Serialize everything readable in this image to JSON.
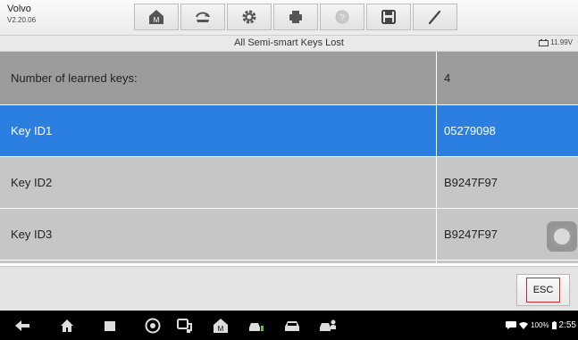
{
  "header": {
    "vehicle_make": "Volvo",
    "version": "V2.20.06"
  },
  "toolbar": {
    "buttons": [
      {
        "name": "home-button",
        "icon": "home-icon"
      },
      {
        "name": "vehicle-swap-button",
        "icon": "car-swap-icon"
      },
      {
        "name": "settings-button",
        "icon": "gear-icon"
      },
      {
        "name": "print-button",
        "icon": "printer-icon"
      },
      {
        "name": "help-button",
        "icon": "help-icon"
      },
      {
        "name": "save-button",
        "icon": "save-icon"
      },
      {
        "name": "edit-button",
        "icon": "pen-icon"
      }
    ]
  },
  "titlebar": {
    "title": "All Semi-smart Keys Lost",
    "voltage": "11.99V"
  },
  "table": {
    "rows": [
      {
        "label": "Number of learned keys:",
        "value": "4"
      },
      {
        "label": "Key ID1",
        "value": "05279098"
      },
      {
        "label": "Key ID2",
        "value": "B9247F97"
      },
      {
        "label": "Key ID3",
        "value": "B9247F97"
      }
    ],
    "selected_index": 1
  },
  "footer": {
    "esc_label": "ESC"
  },
  "status_bar": {
    "battery": "100%",
    "time": "2:55"
  },
  "colors": {
    "selected_row": "#2a7fe0",
    "header_row": "#9c9c9c",
    "normal_row": "#c6c6c6",
    "esc_outline": "#d8262b"
  }
}
